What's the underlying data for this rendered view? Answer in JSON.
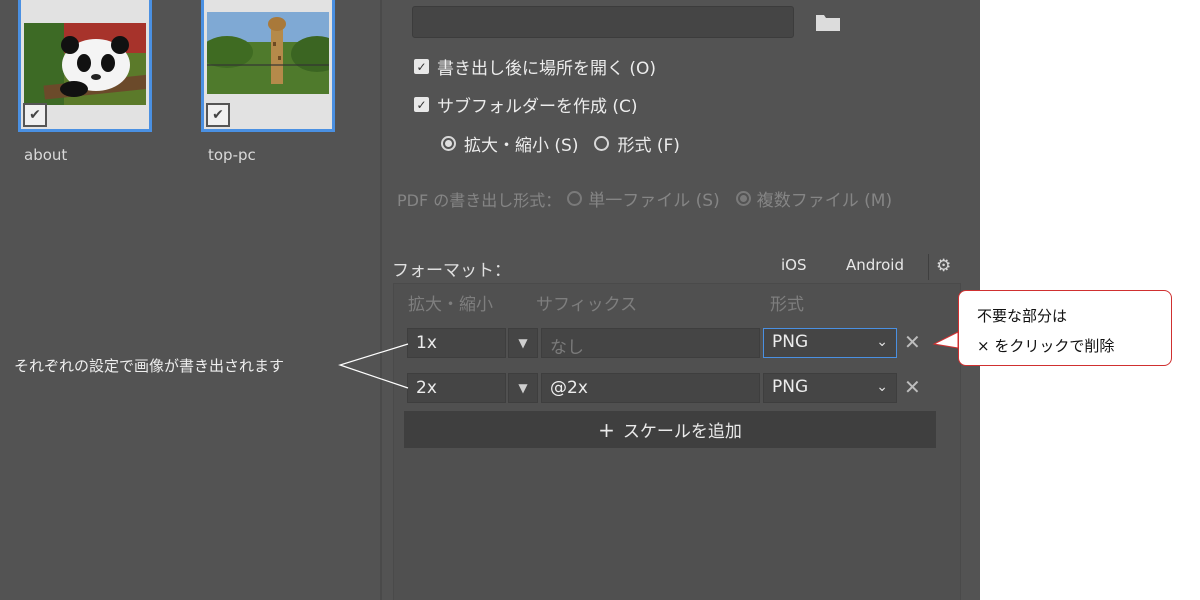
{
  "thumbnails": [
    {
      "label": "about"
    },
    {
      "label": "top-pc"
    }
  ],
  "export_options": {
    "open_location": "書き出し後に場所を開く (O)",
    "create_subfolder": "サブフォルダーを作成 (C)",
    "radio_scale": "拡大・縮小 (S)",
    "radio_format": "形式 (F)"
  },
  "pdf_export": {
    "label": "PDF の書き出し形式：",
    "single_file": "単一ファイル (S)",
    "multiple_files": "複数ファイル (M)"
  },
  "format": {
    "title": "フォーマット：",
    "ios_label": "iOS",
    "android_label": "Android",
    "columns": {
      "scale": "拡大・縮小",
      "suffix": "サフィックス",
      "format": "形式"
    },
    "rows": [
      {
        "scale": "1x",
        "suffix": "",
        "suffix_placeholder": "なし",
        "format": "PNG"
      },
      {
        "scale": "2x",
        "suffix": "@2x",
        "suffix_placeholder": "",
        "format": "PNG"
      }
    ],
    "add_scale": "スケールを追加"
  },
  "annotations": {
    "left": "それぞれの設定で画像が書き出されます",
    "right_line1": "不要な部分は",
    "right_line2": "× をクリックで削除"
  },
  "colors": {
    "panel": "#535353",
    "accent_blue": "#4a90e2",
    "callout_border": "#d03030"
  }
}
